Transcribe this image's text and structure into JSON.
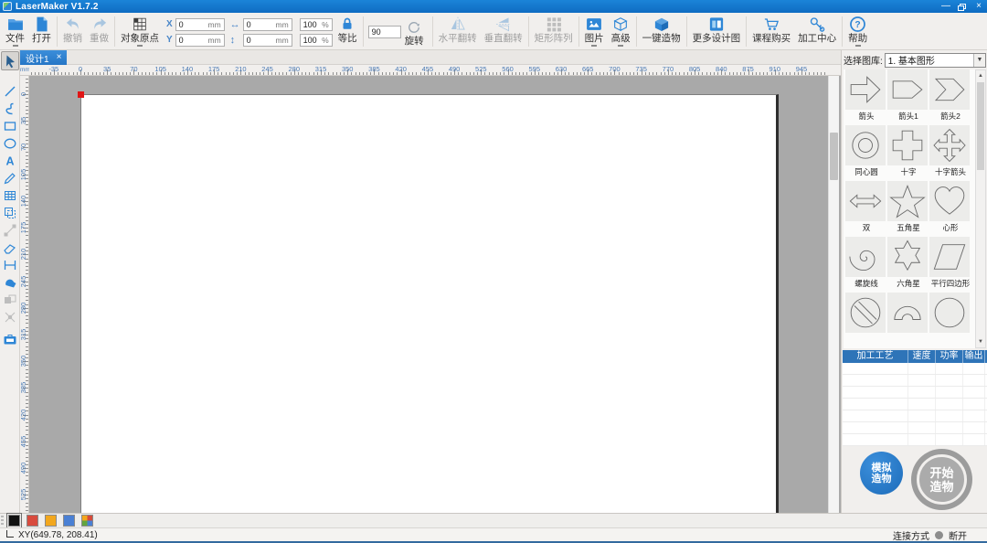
{
  "window": {
    "title": "LaserMaker V1.7.2",
    "close": "×"
  },
  "toolbar": {
    "file": "文件",
    "open": "打开",
    "undo": "撤销",
    "redo": "重做",
    "origin": "对象原点",
    "x_label": "X",
    "y_label": "Y",
    "x_value": "0",
    "y_value": "0",
    "w_value": "0",
    "h_value": "0",
    "w_pct": "100",
    "h_pct": "100",
    "unit_mm": "mm",
    "unit_pct": "%",
    "lock": "等比",
    "angle_value": "90",
    "rotate": "旋转",
    "flip_h": "水平翻转",
    "flip_v": "垂直翻转",
    "array": "矩形阵列",
    "picture": "图片",
    "advanced": "高级",
    "one_key": "一键造物",
    "more_designs": "更多设计图",
    "course_buy": "课程购买",
    "machining_center": "加工中心",
    "help": "帮助"
  },
  "tab": {
    "label": "设计1",
    "close": "×"
  },
  "rulers": {
    "unit": "mm",
    "major_step_mm": 35,
    "minor_step_mm": 5,
    "h_labels": [
      -35,
      0,
      35,
      70,
      105,
      140,
      175,
      210,
      245,
      280,
      315,
      350,
      385,
      420,
      455,
      490,
      525,
      560,
      595,
      630,
      665,
      700,
      735,
      770,
      805,
      840,
      875,
      910,
      945
    ],
    "v_labels": [
      0,
      35,
      70,
      105,
      140,
      175,
      210,
      245,
      280,
      315,
      350,
      385,
      420,
      455,
      490,
      525
    ]
  },
  "left_toolbar": {
    "tools": [
      {
        "name": "select-cursor",
        "active": true
      },
      {
        "name": "line"
      },
      {
        "name": "spline"
      },
      {
        "name": "rectangle"
      },
      {
        "name": "ellipse"
      },
      {
        "name": "text"
      },
      {
        "name": "pencil"
      },
      {
        "name": "grid"
      },
      {
        "name": "offset"
      },
      {
        "name": "node-edit",
        "disabled": true
      },
      {
        "name": "eraser"
      },
      {
        "name": "frame"
      },
      {
        "name": "weld"
      },
      {
        "name": "combine",
        "disabled": true
      },
      {
        "name": "trim",
        "disabled": true
      },
      {
        "name": "toolbox",
        "gap": true
      }
    ]
  },
  "library": {
    "label": "选择图库:",
    "selected": "1. 基本图形",
    "shapes": [
      {
        "name": "arrow",
        "label": "箭头"
      },
      {
        "name": "arrow1",
        "label": "箭头1"
      },
      {
        "name": "arrow2",
        "label": "箭头2"
      },
      {
        "name": "concentric-circles",
        "label": "同心圆"
      },
      {
        "name": "cross",
        "label": "十字"
      },
      {
        "name": "cross-arrow",
        "label": "十字箭头"
      },
      {
        "name": "double-arrow",
        "label": "双"
      },
      {
        "name": "star5",
        "label": "五角星"
      },
      {
        "name": "heart",
        "label": "心形"
      },
      {
        "name": "spiral",
        "label": "螺旋线"
      },
      {
        "name": "star6",
        "label": "六角星"
      },
      {
        "name": "parallelogram",
        "label": "平行四边形"
      },
      {
        "name": "no-symbol",
        "label": ""
      },
      {
        "name": "arch",
        "label": ""
      },
      {
        "name": "circle",
        "label": ""
      }
    ]
  },
  "process_panel": {
    "headers": [
      "加工工艺",
      "速度",
      "功率",
      "输出"
    ],
    "empty_row_count": 7
  },
  "actions": {
    "simulate": "模拟造物",
    "start": "开始造物"
  },
  "status": {
    "coords": "XY(649.78, 208.41)",
    "connection_label": "连接方式",
    "connection_state": "断开"
  },
  "palette": {
    "colors": [
      "#111111",
      "#d84b3e",
      "#f2a71d",
      "#4a80d4",
      "multi"
    ],
    "selected_index": 0
  },
  "colors": {
    "titlebar": "#1580d0",
    "accent": "#2e86d6",
    "workspace_bg": "#a9a9a9",
    "origin_marker": "#e01515",
    "table_header": "#2e74b8",
    "simulate_btn": "#2478c8",
    "start_btn": "#a2a2a2"
  }
}
